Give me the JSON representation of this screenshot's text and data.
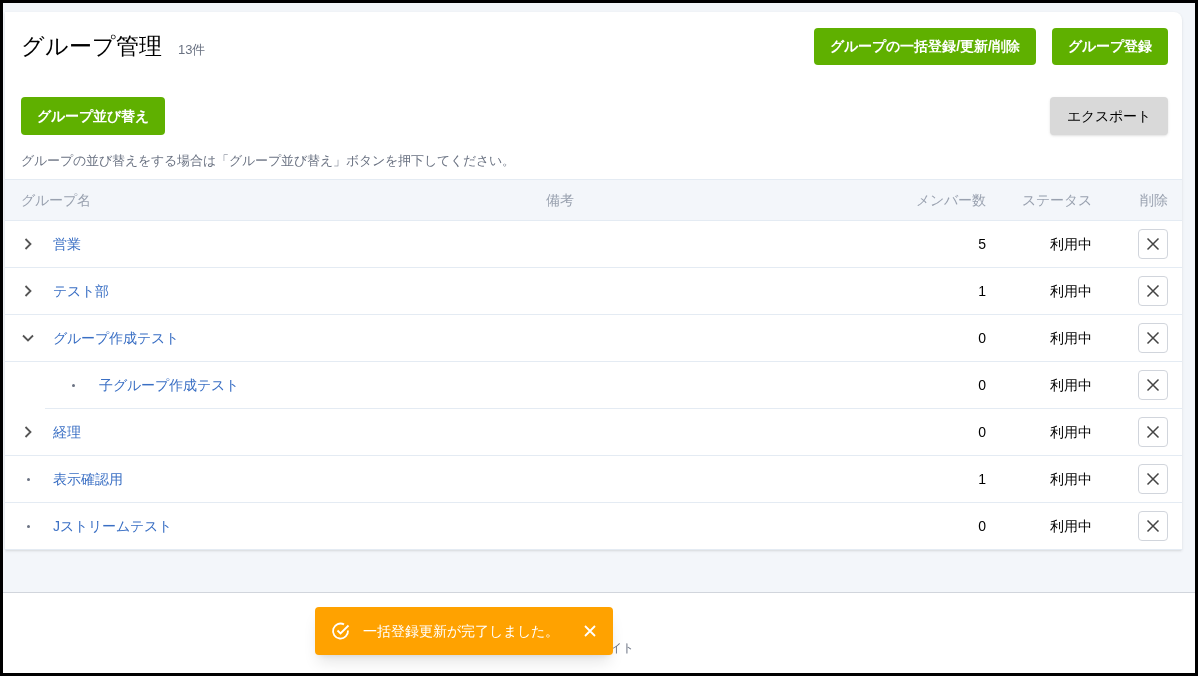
{
  "header": {
    "title": "グループ管理",
    "count": "13件",
    "buttons": [
      "グループの一括登録/更新/削除",
      "グループ登録"
    ]
  },
  "toolbar": {
    "sort_button": "グループ並び替え",
    "export_button": "エクスポート",
    "hint": "グループの並び替えをする場合は「グループ並び替え」ボタンを押下してください。"
  },
  "table": {
    "columns": [
      "グループ名",
      "備考",
      "メンバー数",
      "ステータス",
      "削除"
    ],
    "rows": [
      {
        "kind": "folder",
        "expanded": false,
        "name": "営業",
        "members": "5",
        "status": "利用中"
      },
      {
        "kind": "folder",
        "expanded": false,
        "name": "テスト部",
        "members": "1",
        "status": "利用中"
      },
      {
        "kind": "folder",
        "expanded": true,
        "name": "グループ作成テスト",
        "members": "0",
        "status": "利用中",
        "children": [
          {
            "kind": "leaf",
            "name": "子グループ作成テスト",
            "members": "0",
            "status": "利用中"
          }
        ]
      },
      {
        "kind": "folder",
        "expanded": false,
        "name": "経理",
        "members": "0",
        "status": "利用中"
      },
      {
        "kind": "leaf",
        "name": "表示確認用",
        "members": "1",
        "status": "利用中"
      },
      {
        "kind": "leaf",
        "name": "Jストリームテスト",
        "members": "0",
        "status": "利用中"
      }
    ]
  },
  "footer": {
    "text": "イト"
  },
  "toast": {
    "message": "一括登録更新が完了しました。"
  }
}
